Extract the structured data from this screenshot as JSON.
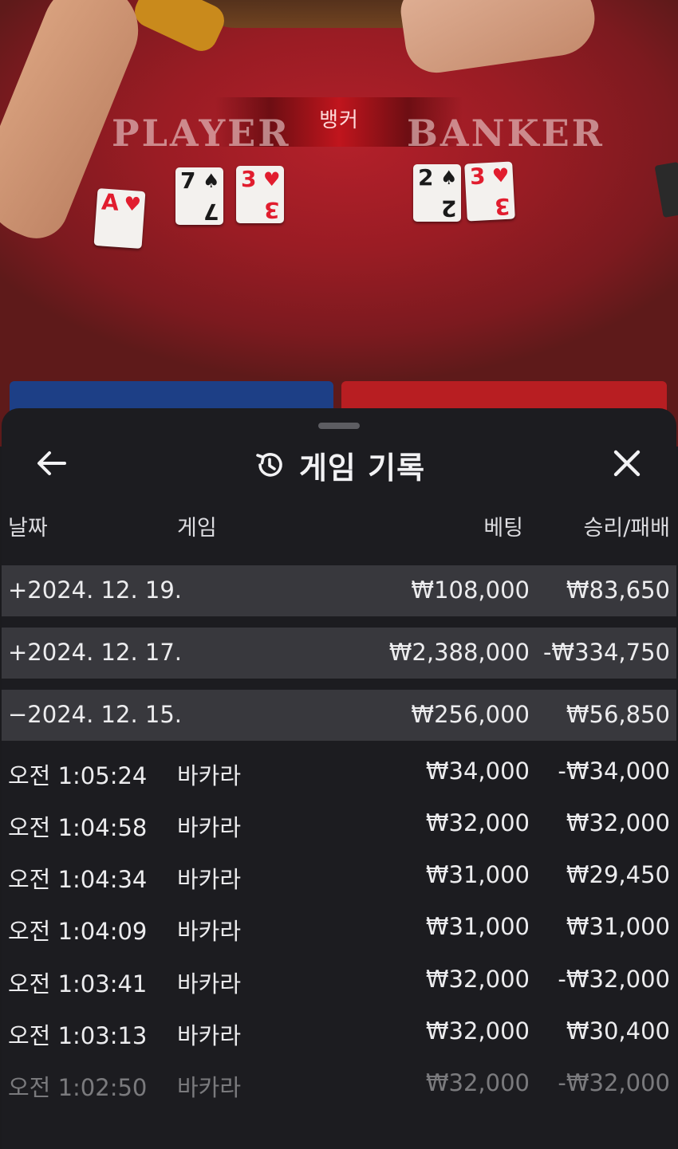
{
  "table": {
    "banner_label": "뱅커",
    "player_word": "PLAYER",
    "banker_word": "BANKER",
    "player_cards": [
      {
        "rank": "A",
        "suit": "♥",
        "color": "red"
      },
      {
        "rank": "7",
        "suit": "♠",
        "color": "black"
      },
      {
        "rank": "3",
        "suit": "♥",
        "color": "red"
      }
    ],
    "banker_cards": [
      {
        "rank": "2",
        "suit": "♠",
        "color": "black"
      },
      {
        "rank": "3",
        "suit": "♥",
        "color": "red"
      }
    ]
  },
  "header": {
    "title": "게임 기록",
    "back_icon": "arrow-left-icon",
    "history_icon": "history-icon",
    "close_icon": "close-icon"
  },
  "columns": {
    "date": "날짜",
    "game": "게임",
    "bet": "베팅",
    "win_loss": "승리/패배"
  },
  "groups": [
    {
      "date": "+2024. 12. 19.",
      "bet": "₩108,000",
      "result": "₩83,650"
    },
    {
      "date": "+2024. 12. 17.",
      "bet": "₩2,388,000",
      "result": "-₩334,750"
    },
    {
      "date": "−2024. 12. 15.",
      "bet": "₩256,000",
      "result": "₩56,850"
    }
  ],
  "rows": [
    {
      "time": "오전 1:05:24",
      "game": "바카라",
      "bet": "₩34,000",
      "result": "-₩34,000"
    },
    {
      "time": "오전 1:04:58",
      "game": "바카라",
      "bet": "₩32,000",
      "result": "₩32,000"
    },
    {
      "time": "오전 1:04:34",
      "game": "바카라",
      "bet": "₩31,000",
      "result": "₩29,450"
    },
    {
      "time": "오전 1:04:09",
      "game": "바카라",
      "bet": "₩31,000",
      "result": "₩31,000"
    },
    {
      "time": "오전 1:03:41",
      "game": "바카라",
      "bet": "₩32,000",
      "result": "-₩32,000"
    },
    {
      "time": "오전 1:03:13",
      "game": "바카라",
      "bet": "₩32,000",
      "result": "₩30,400"
    },
    {
      "time": "오전 1:02:50",
      "game": "바카라",
      "bet": "₩32,000",
      "result": "-₩32,000"
    }
  ],
  "colors": {
    "table_red": "#9a1c24",
    "sheet_bg": "#1c1c20",
    "group_row_bg": "#38383d",
    "player_blue": "#1d3f86",
    "banker_red": "#b81e22"
  }
}
